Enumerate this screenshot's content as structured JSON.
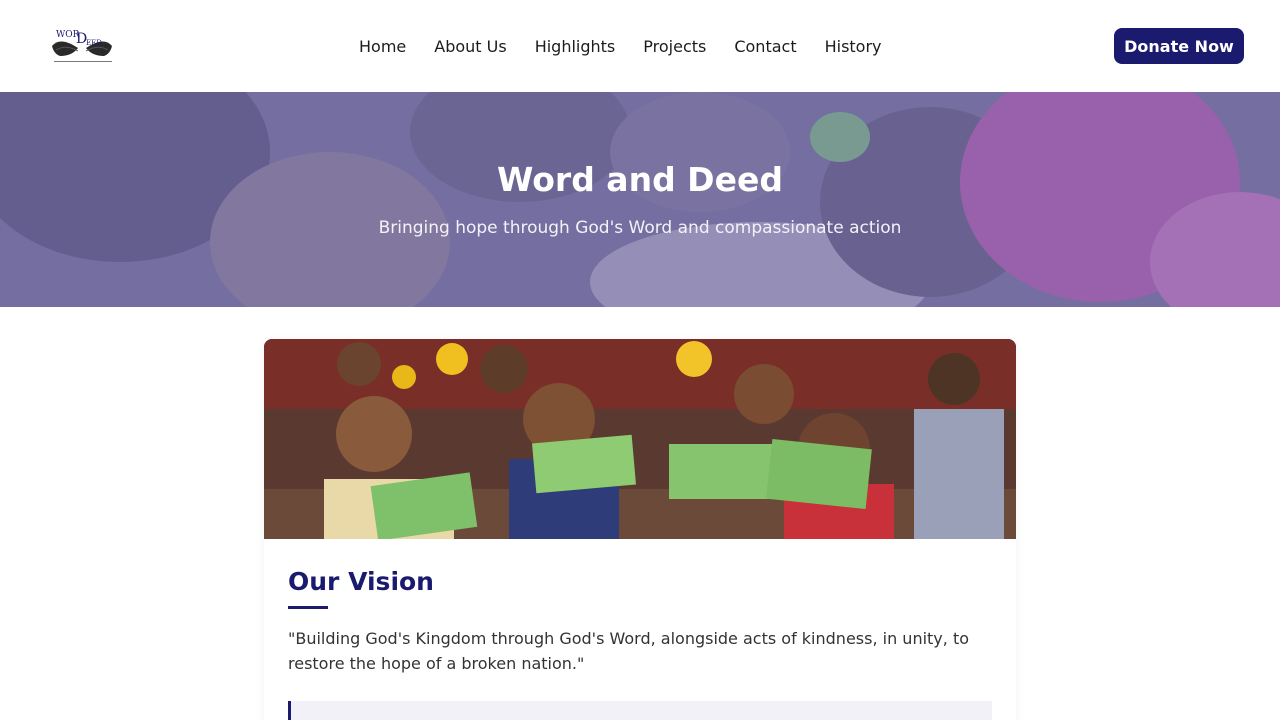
{
  "header": {
    "logo_text": "WORD & DEED",
    "nav": [
      {
        "label": "Home"
      },
      {
        "label": "About Us"
      },
      {
        "label": "Highlights"
      },
      {
        "label": "Projects"
      },
      {
        "label": "Contact"
      },
      {
        "label": "History"
      }
    ],
    "donate_label": "Donate Now"
  },
  "hero": {
    "title": "Word and Deed",
    "subtitle": "Bringing hope through God's Word and compassionate action"
  },
  "vision": {
    "title": "Our Vision",
    "text": "\"Building God's Kingdom through God's Word, alongside acts of kindness, in unity, to restore the hope of a broken nation.\""
  },
  "colors": {
    "brand": "#1a1a6e",
    "hero_overlay": "#7873af"
  }
}
